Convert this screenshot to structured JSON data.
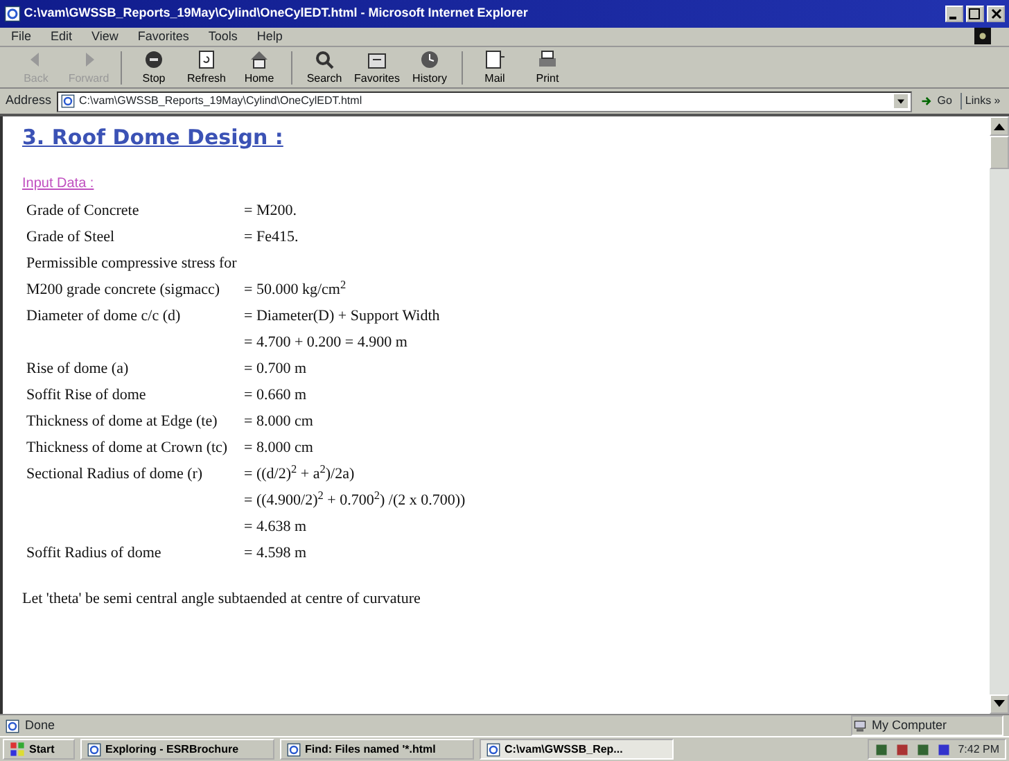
{
  "window": {
    "title": "C:\\vam\\GWSSB_Reports_19May\\Cylind\\OneCylEDT.html - Microsoft Internet Explorer"
  },
  "menu": [
    "File",
    "Edit",
    "View",
    "Favorites",
    "Tools",
    "Help"
  ],
  "toolbar": [
    {
      "label": "Back",
      "disabled": true
    },
    {
      "label": "Forward",
      "disabled": true
    },
    {
      "label": "Stop",
      "disabled": false
    },
    {
      "label": "Refresh",
      "disabled": false
    },
    {
      "label": "Home",
      "disabled": false
    },
    {
      "label": "Search",
      "disabled": false
    },
    {
      "label": "Favorites",
      "disabled": false
    },
    {
      "label": "History",
      "disabled": false
    },
    {
      "label": "Mail",
      "disabled": false
    },
    {
      "label": "Print",
      "disabled": false
    }
  ],
  "address": {
    "label": "Address",
    "value": "C:\\vam\\GWSSB_Reports_19May\\Cylind\\OneCylEDT.html",
    "go": "Go",
    "links": "Links »"
  },
  "page": {
    "heading": "3. Roof Dome Design :",
    "subheading": "Input Data :",
    "rows": [
      {
        "label": "Grade of Concrete",
        "value": "= M200."
      },
      {
        "label": "Grade of Steel",
        "value": "= Fe415."
      },
      {
        "label": "Permissible compressive stress for",
        "value": ""
      },
      {
        "label": "M200 grade concrete (sigmacc)",
        "value": "= 50.000 kg/cm$^{2}$"
      },
      {
        "label": "Diameter of dome c/c (d)",
        "value": "= Diameter(D) + Support Width"
      },
      {
        "label": "",
        "value": "= 4.700 + 0.200 = 4.900 m"
      },
      {
        "label": "Rise of dome (a)",
        "value": "= 0.700 m"
      },
      {
        "label": "Soffit Rise of dome",
        "value": "= 0.660 m"
      },
      {
        "label": "Thickness of dome at Edge (te)",
        "value": "= 8.000 cm"
      },
      {
        "label": "Thickness of dome at Crown (tc)",
        "value": "= 8.000 cm"
      },
      {
        "label": "Sectional Radius of dome (r)",
        "value": "= ((d/2)$^{2}$ + a$^{2}$)/2a)"
      },
      {
        "label": "",
        "value": "= ((4.900/2)$^{2}$ + 0.700$^{2}$) /(2 x 0.700))"
      },
      {
        "label": "",
        "value": "= 4.638 m"
      },
      {
        "label": "Soffit Radius of dome",
        "value": "= 4.598 m"
      }
    ],
    "note": "Let 'theta' be semi central angle subtaended at centre of curvature"
  },
  "status_bar": {
    "text": "Done",
    "zone": "My Computer"
  },
  "taskbar": {
    "start": "Start",
    "items": [
      {
        "label": "Exploring - ESRBrochure",
        "selected": false
      },
      {
        "label": "Find: Files named '*.html",
        "selected": false
      },
      {
        "label": "C:\\vam\\GWSSB_Rep...",
        "selected": true
      }
    ],
    "clock": "7:42 PM"
  }
}
